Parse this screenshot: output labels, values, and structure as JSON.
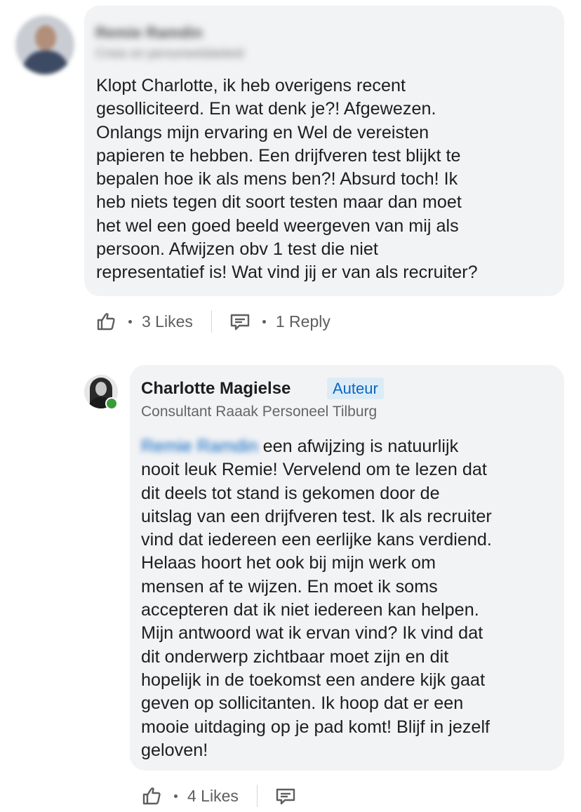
{
  "comments": [
    {
      "author_name": "Remie Ramdin",
      "author_headline": "Crisis en personeelsbeleid",
      "text": "Klopt Charlotte, ik heb overigens recent\ngesolliciteerd. En wat denk je?! Afgewezen.\nOnlangs mijn ervaring en Wel de vereisten\npapieren te hebben. Een drijfveren test blijkt te\nbepalen hoe ik als mens ben?! Absurd toch! Ik\nheb niets tegen dit soort testen maar dan moet\nhet wel een goed beeld weergeven van mij als\npersoon. Afwijzen obv 1 test die niet\nrepresentatief is! Wat vind jij er van als recruiter?",
      "likes_label": "3 Likes",
      "reply_label": "1 Reply"
    },
    {
      "author_name": "Charlotte Magielse",
      "author_badge": "Auteur",
      "author_headline": "Consultant Raaak Personeel Tilburg",
      "mention": "Remie Ramdin",
      "text": " een afwijzing is natuurlijk\nnooit leuk Remie! Vervelend om te lezen dat\ndit deels tot stand is gekomen door de\nuitslag van een drijfveren test. Ik als recruiter\nvind dat iedereen een eerlijke kans verdiend.\nHelaas hoort het ook bij mijn werk om\nmensen af te wijzen. En moet ik soms\naccepteren dat ik niet iedereen kan helpen.\nMijn antwoord wat ik ervan vind? Ik vind dat\ndit onderwerp zichtbaar moet zijn en dit\nhopelijk in de toekomst een andere kijk gaat\ngeven op sollicitanten. Ik hoop dat er een\nmooie uitdaging op je pad komt! Blijf in jezelf\ngeloven!",
      "likes_label": "4 Likes",
      "presence_status": "online"
    }
  ],
  "icons": {
    "like": "thumbs-up-icon",
    "reply": "reply-icon",
    "presence": "online-status-dot"
  },
  "colors": {
    "bubble_bg": "#f2f3f5",
    "badge_bg": "#dcecf7",
    "badge_text": "#0a66c2",
    "presence_green": "#3a9b3a"
  }
}
